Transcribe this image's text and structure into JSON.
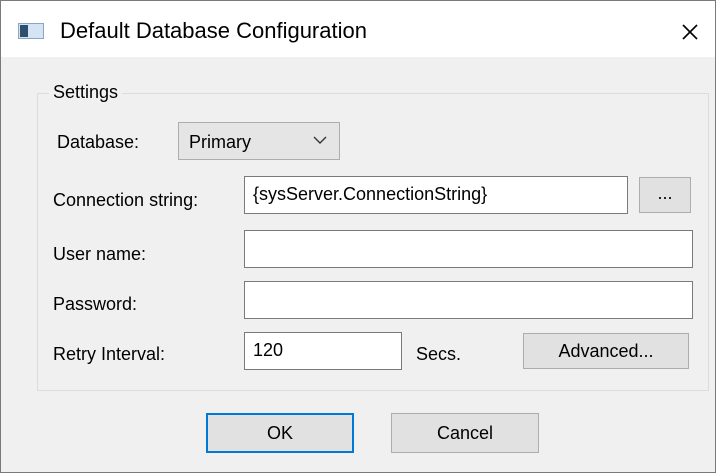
{
  "window": {
    "title": "Default Database Configuration",
    "icon": "window-icon",
    "close_icon": "close-icon"
  },
  "settings": {
    "group_title": "Settings",
    "database": {
      "label": "Database:",
      "value": "Primary",
      "arrow_icon": "chevron-down-icon"
    },
    "connection_string": {
      "label": "Connection string:",
      "value": "{sysServer.ConnectionString}",
      "browse_label": "..."
    },
    "user_name": {
      "label": "User name:",
      "value": ""
    },
    "password": {
      "label": "Password:",
      "value": ""
    },
    "retry_interval": {
      "label": "Retry Interval:",
      "value": "120",
      "unit": "Secs.",
      "advanced_label": "Advanced..."
    }
  },
  "buttons": {
    "ok": "OK",
    "cancel": "Cancel"
  },
  "colors": {
    "accent": "#0078d7",
    "dialog_bg": "#f0f0f0",
    "button_bg": "#e1e1e1"
  }
}
